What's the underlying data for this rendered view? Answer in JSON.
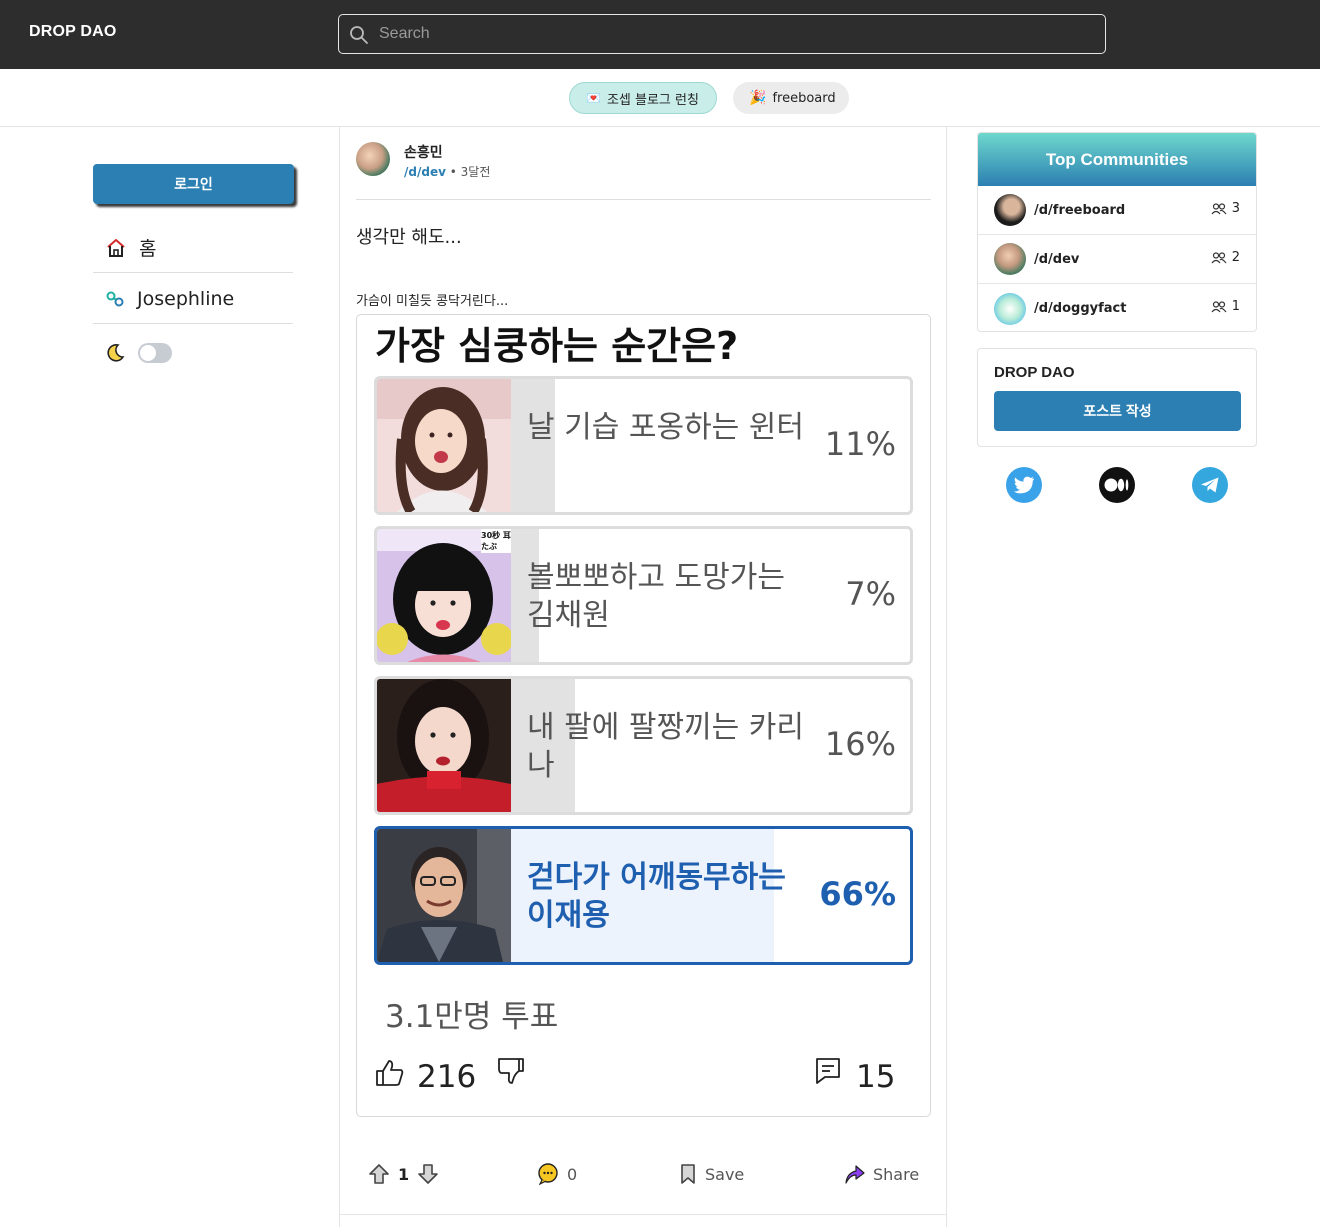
{
  "app": {
    "brand": "DROP DAO"
  },
  "search": {
    "placeholder": "Search"
  },
  "chips": [
    {
      "label": "조셉 블로그 런칭",
      "icon": "heart-letter-icon"
    },
    {
      "label": "freeboard",
      "icon": "party-popper-icon"
    }
  ],
  "sidebar": {
    "login_label": "로그인",
    "items": [
      {
        "label": "홈",
        "icon": "home-icon"
      },
      {
        "label": "Josephline",
        "icon": "link-icon"
      }
    ],
    "theme_icon": "moon-icon"
  },
  "post": {
    "author": "손흥민",
    "community": "/d/dev",
    "time": "3달전",
    "title": "생각만 해도...",
    "body": "가슴이 미칠듯 콩닥거린다...",
    "poll": {
      "question": "가장 심쿵하는 순간은?",
      "options": [
        {
          "label": "날 기습 포옹하는 윈터",
          "percent_text": "11%",
          "percent": 11
        },
        {
          "label": "볼뽀뽀하고 도망가는 김채원",
          "percent_text": "7%",
          "percent": 7
        },
        {
          "label": "내 팔에 팔짱끼는 카리나",
          "percent_text": "16%",
          "percent": 16
        },
        {
          "label": "걷다가 어깨동무하는 이재용",
          "percent_text": "66%",
          "percent": 66,
          "selected": true
        }
      ],
      "votes": "3.1만명 투표",
      "likes": "216",
      "comments": "15",
      "overlay_text": "30秒 耳たぶ"
    },
    "actions": {
      "upvotes": "1",
      "comments": "0",
      "save_label": "Save",
      "share_label": "Share"
    }
  },
  "right": {
    "top_communities_title": "Top Communities",
    "communities": [
      {
        "name": "/d/freeboard",
        "members": "3"
      },
      {
        "name": "/d/dev",
        "members": "2"
      },
      {
        "name": "/d/doggyfact",
        "members": "1"
      }
    ],
    "dao_title": "DROP DAO",
    "write_post_label": "포스트 작성",
    "socials": [
      "twitter-icon",
      "medium-icon",
      "telegram-icon"
    ]
  },
  "colors": {
    "accent": "#2b7fb2",
    "winner": "#1f5fb0",
    "topbar": "#2d2d2d"
  }
}
